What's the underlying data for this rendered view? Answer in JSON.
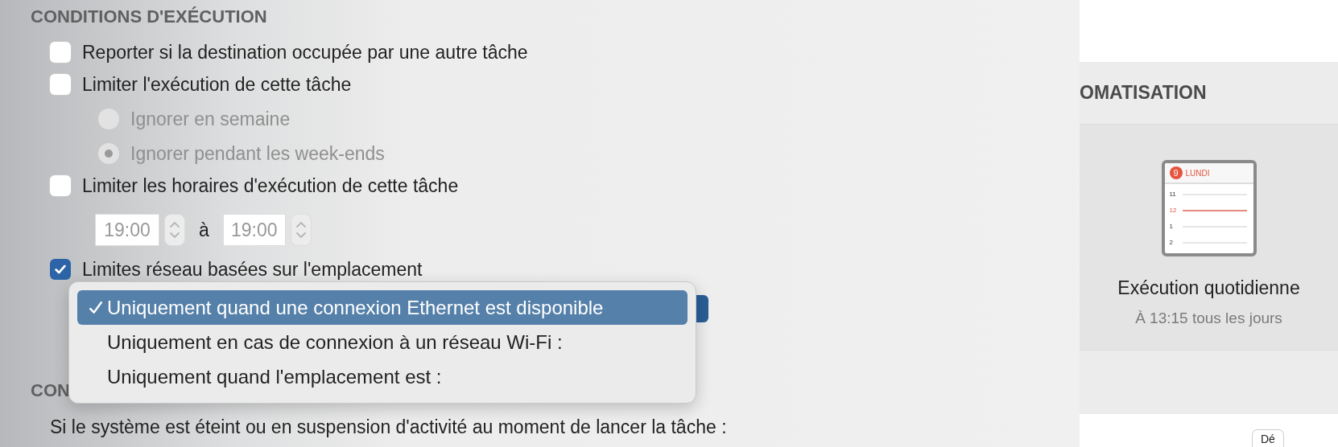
{
  "section_title": "CONDITIONS D'EXÉCUTION",
  "options": [
    {
      "kind": "checkbox",
      "label": "Reporter si la destination occupée par une autre tâche",
      "checked": false,
      "disabled": false
    },
    {
      "kind": "checkbox",
      "label": "Limiter l'exécution de cette tâche",
      "checked": false,
      "disabled": false
    },
    {
      "kind": "radio",
      "label": "Ignorer en semaine",
      "selected": false,
      "disabled": true
    },
    {
      "kind": "radio",
      "label": "Ignorer pendant les week-ends",
      "selected": true,
      "disabled": true
    },
    {
      "kind": "checkbox",
      "label": "Limiter les horaires d'exécution de cette tâche",
      "checked": false,
      "disabled": false
    },
    {
      "kind": "time_range",
      "start": "19:00",
      "separator": "à",
      "end": "19:00",
      "disabled": true
    },
    {
      "kind": "checkbox",
      "label": "Limites réseau basées sur l'emplacement",
      "checked": true,
      "disabled": false
    },
    {
      "kind": "dropdown"
    }
  ],
  "network_menu": [
    {
      "label": "Uniquement quand une connexion Ethernet est disponible",
      "selected": true
    },
    {
      "label": "Uniquement en cas de connexion à un réseau Wi-Fi :",
      "selected": false
    },
    {
      "label": "Uniquement quand l'emplacement est :",
      "selected": false
    }
  ],
  "second_section_title": "CON",
  "second_section_text": "Si le système est éteint ou en suspension d'activité au moment de lancer la tâche :",
  "automation_title": "OMATISATION",
  "schedule": {
    "day": "9",
    "weekday": "LUNDI",
    "hours": [
      {
        "label": "11",
        "current": false
      },
      {
        "label": "12",
        "current": true
      },
      {
        "label": "1",
        "current": false
      },
      {
        "label": "2",
        "current": false
      }
    ],
    "title": "Exécution quotidienne",
    "subtitle": "À 13:15 tous les jours"
  },
  "bottom_button": "Dé"
}
